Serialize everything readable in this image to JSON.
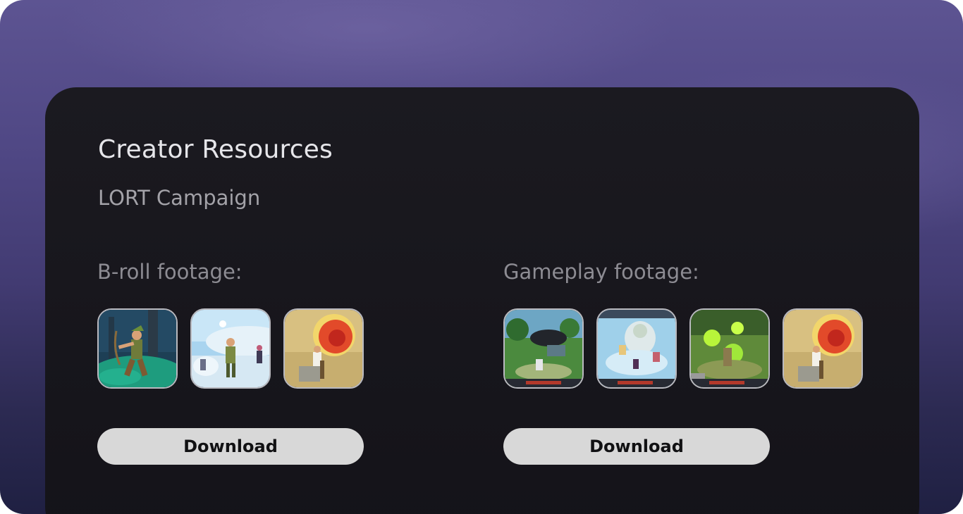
{
  "panel": {
    "title": "Creator Resources",
    "subtitle": "LORT Campaign"
  },
  "sections": [
    {
      "label": "B-roll footage:",
      "thumbnails": [
        "broll-archer-forest",
        "broll-snow-battle",
        "broll-fire-explosion"
      ],
      "download_label": "Download"
    },
    {
      "label": "Gameplay footage:",
      "thumbnails": [
        "gameplay-forest-dragon",
        "gameplay-ice-boss",
        "gameplay-green-magic",
        "gameplay-fire-explosion"
      ],
      "download_label": "Download"
    }
  ],
  "colors": {
    "background_top": "#5d5492",
    "background_bottom": "#1f2042",
    "panel": "#17161c",
    "title": "#e6e6ea",
    "subtitle": "#a3a2a8",
    "section_label": "#8d8c93",
    "button_bg": "#d8d8d8",
    "button_text": "#111113"
  }
}
